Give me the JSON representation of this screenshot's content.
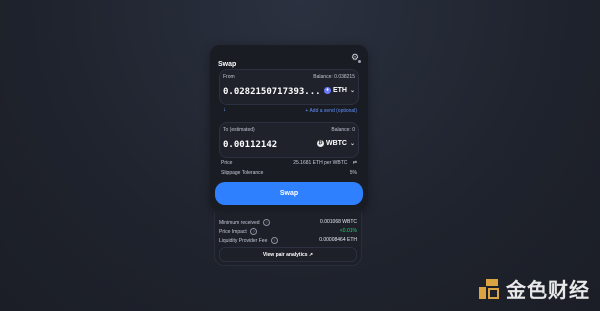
{
  "card": {
    "title": "Swap",
    "from": {
      "label": "From",
      "balance": "Balance: 0.038215",
      "amount": "0.0282150717393...",
      "token": "ETH"
    },
    "add_send": "+ Add a send (optional)",
    "to": {
      "label": "To (estimated)",
      "balance": "Balance: 0",
      "amount": "0.00112142",
      "token": "WBTC"
    },
    "price_label": "Price",
    "price_value": "25.1681 ETH per WBTC",
    "slippage_label": "Slippage Tolerance",
    "slippage_value": "5%",
    "swap_button": "Swap"
  },
  "footer": {
    "min_received_label": "Minimum received",
    "min_received_value": "0.001068 WBTC",
    "price_impact_label": "Price Impact",
    "price_impact_value": "<0.01%",
    "lp_fee_label": "Liquidity Provider Fee",
    "lp_fee_value": "0.00008464 ETH",
    "analytics_link": "View pair analytics ↗"
  },
  "watermark": {
    "text": "金色财经"
  },
  "colors": {
    "accent": "#2f80ff",
    "impact": "#2bd171"
  },
  "icons": {
    "settings": "gear-icon",
    "swap_arrow": "arrow-down-icon",
    "price_swap": "swap-arrows-icon",
    "info": "question-icon"
  }
}
